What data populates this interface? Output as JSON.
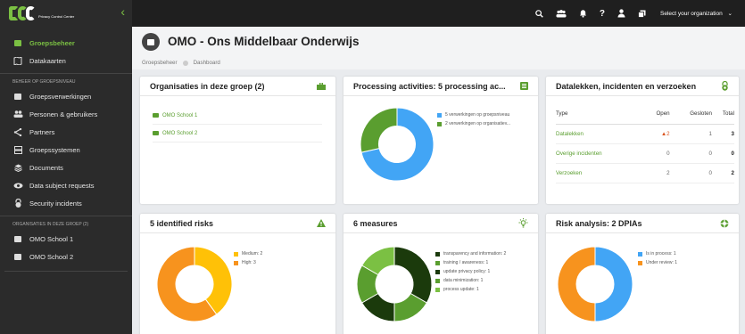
{
  "brand": {
    "logo_text": "PCC",
    "subtitle": "Privacy Control Center"
  },
  "sidebar": {
    "top_items": [
      {
        "label": "Groepsbeheer",
        "icon": "folder-icon",
        "active": true
      },
      {
        "label": "Datakaarten",
        "icon": "map-icon",
        "active": false
      }
    ],
    "section1_heading": "BEHEER OP GROEPSNIVEAU",
    "section1_items": [
      {
        "label": "Groepsverwerkingen",
        "icon": "document-icon"
      },
      {
        "label": "Personen & gebruikers",
        "icon": "users-icon"
      },
      {
        "label": "Partners",
        "icon": "share-icon"
      },
      {
        "label": "Groepssystemen",
        "icon": "server-icon"
      },
      {
        "label": "Documents",
        "icon": "stack-icon"
      },
      {
        "label": "Data subject requests",
        "icon": "eye-icon"
      },
      {
        "label": "Security incidents",
        "icon": "lock-icon"
      }
    ],
    "section2_heading": "ORGANISATIES IN DEZE GROEP (2)",
    "section2_items": [
      {
        "label": "OMO School 1",
        "icon": "briefcase-icon"
      },
      {
        "label": "OMO School 2",
        "icon": "briefcase-icon"
      }
    ]
  },
  "topbar": {
    "org_select": "Select your organization"
  },
  "header": {
    "title": "OMO - Ons Middelbaar Onderwijs",
    "breadcrumb": [
      "Groepsbeheer",
      "Dashboard"
    ]
  },
  "colors": {
    "green": "#5a9e2f",
    "light_green": "#7bc043",
    "blue": "#42a5f5",
    "orange": "#f7931e",
    "yellow": "#ffc107",
    "dark_green": "#1b3a0c",
    "warn": "#d9531e"
  },
  "cards": {
    "orgs": {
      "title": "Organisaties in deze groep (2)",
      "items": [
        "OMO School 1",
        "OMO School 2"
      ]
    },
    "processing": {
      "title": "Processing activities: 5 processing ac...",
      "legend": [
        "5 verwerkingen op groepsniveau",
        "2 verwerkingen op organisatiev..."
      ],
      "values": [
        5,
        2
      ]
    },
    "breaches": {
      "title": "Datalekken, incidenten en verzoeken",
      "columns": [
        "Type",
        "Open",
        "Gesloten",
        "Total"
      ],
      "rows": [
        {
          "type": "Datalekken",
          "open": "2",
          "closed": "1",
          "total": "3"
        },
        {
          "type": "Overige incidenten",
          "open": "0",
          "closed": "0",
          "total": "0"
        },
        {
          "type": "Verzoeken",
          "open": "2",
          "closed": "0",
          "total": "2"
        }
      ]
    },
    "risks": {
      "title": "5 identified risks",
      "legend": [
        "Medium: 2",
        "High: 3"
      ],
      "values": [
        2,
        3
      ]
    },
    "measures": {
      "title": "6 measures",
      "legend": [
        "transparency and information: 2",
        "training / awareness: 1",
        "update privacy policy: 1",
        "data minimization: 1",
        "process update: 1"
      ],
      "values": [
        2,
        1,
        1,
        1,
        1
      ]
    },
    "dpia": {
      "title": "Risk analysis: 2 DPIAs",
      "legend": [
        "Is in process: 1",
        "Under review: 1"
      ],
      "values": [
        1,
        1
      ]
    }
  }
}
